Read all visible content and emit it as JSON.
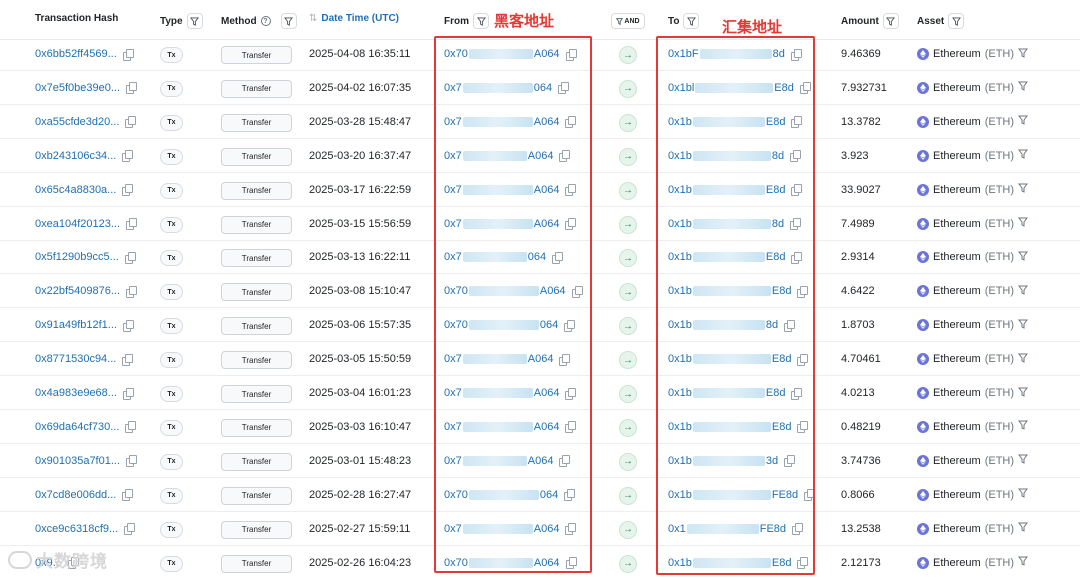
{
  "header": {
    "tx_hash": "Transaction Hash",
    "type": "Type",
    "method": "Method",
    "date_time": "Date Time (UTC)",
    "from": "From",
    "and": "AND",
    "to": "To",
    "amount": "Amount",
    "asset": "Asset"
  },
  "annotations": {
    "from_label": "黑客地址",
    "to_label": "汇集地址",
    "watermark": "大数跨境"
  },
  "colors": {
    "link": "#1f6fb2",
    "annotation_red": "#e53935",
    "eth": "#6b74d8"
  },
  "rows": [
    {
      "hash": "0x6bb52ff4569...",
      "type": "Tx",
      "method": "Transfer",
      "date": "2025-04-08 16:35:11",
      "from_pre": "0x70",
      "from_suf": "A064",
      "to_pre": "0x1bF",
      "to_suf": "8d",
      "amount": "9.46369",
      "asset": "Ethereum",
      "asset_sym": "(ETH)"
    },
    {
      "hash": "0x7e5f0be39e0...",
      "type": "Tx",
      "method": "Transfer",
      "date": "2025-04-02 16:07:35",
      "from_pre": "0x7",
      "from_suf": "064",
      "to_pre": "0x1bl",
      "to_suf": "E8d",
      "amount": "7.932731",
      "asset": "Ethereum",
      "asset_sym": "(ETH)"
    },
    {
      "hash": "0xa55cfde3d20...",
      "type": "Tx",
      "method": "Transfer",
      "date": "2025-03-28 15:48:47",
      "from_pre": "0x7",
      "from_suf": "A064",
      "to_pre": "0x1b",
      "to_suf": "E8d",
      "amount": "13.3782",
      "asset": "Ethereum",
      "asset_sym": "(ETH)"
    },
    {
      "hash": "0xb243106c34...",
      "type": "Tx",
      "method": "Transfer",
      "date": "2025-03-20 16:37:47",
      "from_pre": "0x7",
      "from_suf": "A064",
      "to_pre": "0x1b",
      "to_suf": "8d",
      "amount": "3.923",
      "asset": "Ethereum",
      "asset_sym": "(ETH)"
    },
    {
      "hash": "0x65c4a8830a...",
      "type": "Tx",
      "method": "Transfer",
      "date": "2025-03-17 16:22:59",
      "from_pre": "0x7",
      "from_suf": "A064",
      "to_pre": "0x1b",
      "to_suf": "E8d",
      "amount": "33.9027",
      "asset": "Ethereum",
      "asset_sym": "(ETH)"
    },
    {
      "hash": "0xea104f20123...",
      "type": "Tx",
      "method": "Transfer",
      "date": "2025-03-15 15:56:59",
      "from_pre": "0x7",
      "from_suf": "A064",
      "to_pre": "0x1b",
      "to_suf": "8d",
      "amount": "7.4989",
      "asset": "Ethereum",
      "asset_sym": "(ETH)"
    },
    {
      "hash": "0x5f1290b9cc5...",
      "type": "Tx",
      "method": "Transfer",
      "date": "2025-03-13 16:22:11",
      "from_pre": "0x7",
      "from_suf": "064",
      "to_pre": "0x1b",
      "to_suf": "E8d",
      "amount": "2.9314",
      "asset": "Ethereum",
      "asset_sym": "(ETH)"
    },
    {
      "hash": "0x22bf5409876...",
      "type": "Tx",
      "method": "Transfer",
      "date": "2025-03-08 15:10:47",
      "from_pre": "0x70",
      "from_suf": "A064",
      "to_pre": "0x1b",
      "to_suf": "E8d",
      "amount": "4.6422",
      "asset": "Ethereum",
      "asset_sym": "(ETH)"
    },
    {
      "hash": "0x91a49fb12f1...",
      "type": "Tx",
      "method": "Transfer",
      "date": "2025-03-06 15:57:35",
      "from_pre": "0x70",
      "from_suf": "064",
      "to_pre": "0x1b",
      "to_suf": "8d",
      "amount": "1.8703",
      "asset": "Ethereum",
      "asset_sym": "(ETH)"
    },
    {
      "hash": "0x8771530c94...",
      "type": "Tx",
      "method": "Transfer",
      "date": "2025-03-05 15:50:59",
      "from_pre": "0x7",
      "from_suf": "A064",
      "to_pre": "0x1b",
      "to_suf": "E8d",
      "amount": "4.70461",
      "asset": "Ethereum",
      "asset_sym": "(ETH)"
    },
    {
      "hash": "0x4a983e9e68...",
      "type": "Tx",
      "method": "Transfer",
      "date": "2025-03-04 16:01:23",
      "from_pre": "0x7",
      "from_suf": "A064",
      "to_pre": "0x1b",
      "to_suf": "E8d",
      "amount": "4.0213",
      "asset": "Ethereum",
      "asset_sym": "(ETH)"
    },
    {
      "hash": "0x69da64cf730...",
      "type": "Tx",
      "method": "Transfer",
      "date": "2025-03-03 16:10:47",
      "from_pre": "0x7",
      "from_suf": "A064",
      "to_pre": "0x1b",
      "to_suf": "E8d",
      "amount": "0.48219",
      "asset": "Ethereum",
      "asset_sym": "(ETH)"
    },
    {
      "hash": "0x901035a7f01...",
      "type": "Tx",
      "method": "Transfer",
      "date": "2025-03-01 15:48:23",
      "from_pre": "0x7",
      "from_suf": "A064",
      "to_pre": "0x1b",
      "to_suf": "3d",
      "amount": "3.74736",
      "asset": "Ethereum",
      "asset_sym": "(ETH)"
    },
    {
      "hash": "0x7cd8e006dd...",
      "type": "Tx",
      "method": "Transfer",
      "date": "2025-02-28 16:27:47",
      "from_pre": "0x70",
      "from_suf": "064",
      "to_pre": "0x1b",
      "to_suf": "FE8d",
      "amount": "0.8066",
      "asset": "Ethereum",
      "asset_sym": "(ETH)"
    },
    {
      "hash": "0xce9c6318cf9...",
      "type": "Tx",
      "method": "Transfer",
      "date": "2025-02-27 15:59:11",
      "from_pre": "0x7",
      "from_suf": "A064",
      "to_pre": "0x1",
      "to_suf": "FE8d",
      "amount": "13.2538",
      "asset": "Ethereum",
      "asset_sym": "(ETH)"
    },
    {
      "hash": "0x9...",
      "type": "Tx",
      "method": "Transfer",
      "date": "2025-02-26 16:04:23",
      "from_pre": "0x70",
      "from_suf": "A064",
      "to_pre": "0x1b",
      "to_suf": "E8d",
      "amount": "2.12173",
      "asset": "Ethereum",
      "asset_sym": "(ETH)"
    }
  ]
}
